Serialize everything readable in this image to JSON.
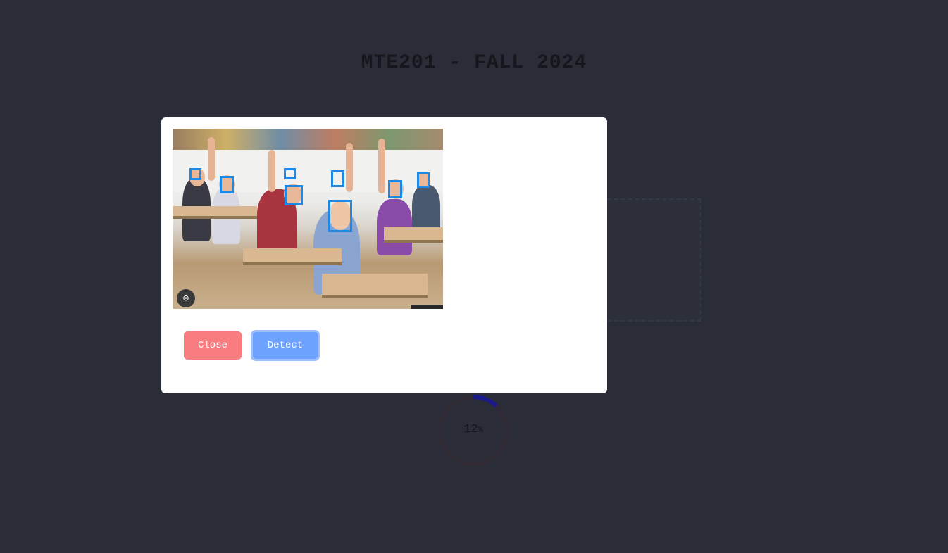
{
  "page": {
    "title": "MTE201 - FALL 2024"
  },
  "progress": {
    "value": "12",
    "unit": "%",
    "fraction": 0.12,
    "track_color": "#2f2a33",
    "fill_color": "#1a1a8a"
  },
  "modal": {
    "image": {
      "faces_detected": 9,
      "box_color": "#1e88e5",
      "lens_icon": "lens-search-icon"
    },
    "buttons": {
      "close_label": "Close",
      "detect_label": "Detect"
    }
  },
  "colors": {
    "background": "#2a2d38",
    "close_button": "#f87c80",
    "detect_button": "#6ea2ff",
    "modal": "#ffffff"
  }
}
